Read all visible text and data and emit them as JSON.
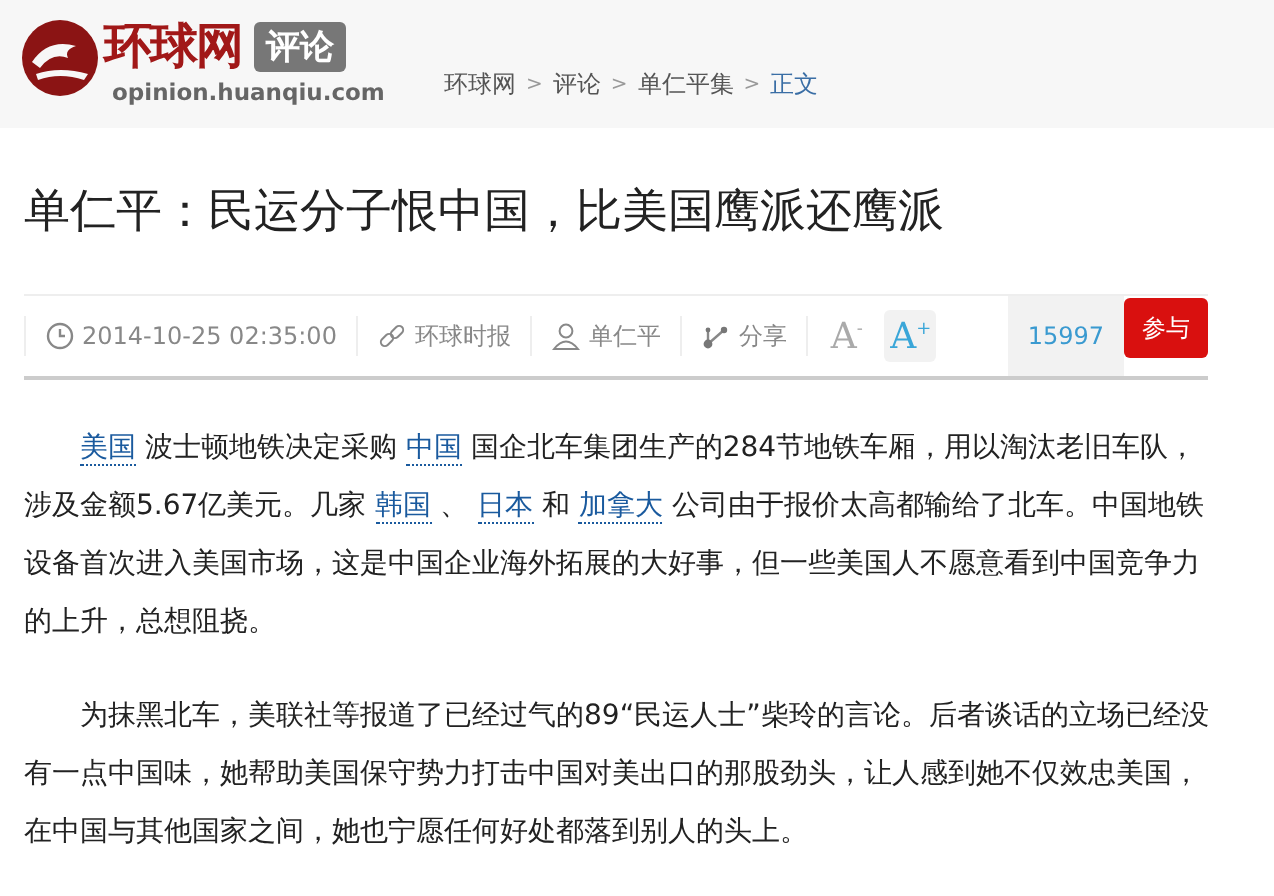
{
  "header": {
    "logo_text": "环球网",
    "logo_badge": "评论",
    "logo_domain": "opinion.huanqiu.com"
  },
  "breadcrumb": [
    {
      "label": "环球网",
      "current": false
    },
    {
      "label": "评论",
      "current": false
    },
    {
      "label": "单仁平集",
      "current": false
    },
    {
      "label": "正文",
      "current": true
    }
  ],
  "breadcrumb_separator": ">",
  "article": {
    "title": "单仁平：民运分子恨中国，比美国鹰派还鹰派",
    "meta": {
      "time": "2014-10-25 02:35:00",
      "source": "环球时报",
      "author": "单仁平",
      "share": "分享",
      "font_smaller": "A",
      "font_smaller_mark": "-",
      "font_larger": "A",
      "font_larger_mark": "+",
      "comment_count": "15997",
      "join": "参与"
    },
    "paragraphs": [
      [
        {
          "kind": "link",
          "text": "美国"
        },
        {
          "kind": "text",
          "text": " 波士顿地铁决定采购 "
        },
        {
          "kind": "link",
          "text": "中国"
        },
        {
          "kind": "text",
          "text": " 国企北车集团生产的284节地铁车厢，用以淘汰老旧车队，涉及金额5.67亿美元。几家 "
        },
        {
          "kind": "link",
          "text": "韩国"
        },
        {
          "kind": "text",
          "text": " 、 "
        },
        {
          "kind": "link",
          "text": "日本"
        },
        {
          "kind": "text",
          "text": " 和 "
        },
        {
          "kind": "link",
          "text": "加拿大"
        },
        {
          "kind": "text",
          "text": " 公司由于报价太高都输给了北车。中国地铁设备首次进入美国市场，这是中国企业海外拓展的大好事，但一些美国人不愿意看到中国竞争力的上升，总想阻挠。"
        }
      ],
      [
        {
          "kind": "text",
          "text": "为抹黑北车，美联社等报道了已经过气的89“民运人士”柴玲的言论。后者谈话的立场已经没有一点中国味，她帮助美国保守势力打击中国对美出口的那股劲头，让人感到她不仅效忠美国，在中国与其他国家之间，她也宁愿任何好处都落到别人的头上。"
        }
      ]
    ]
  }
}
